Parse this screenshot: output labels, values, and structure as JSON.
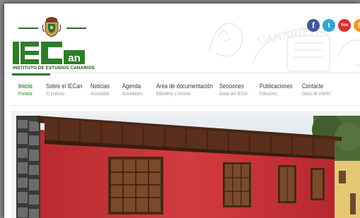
{
  "site": {
    "name_mark": "IECan",
    "tagline": "INSTITUTO DE ESTUDIOS CANARIOS",
    "watermark_text": "CANARIENSIUM"
  },
  "social": [
    {
      "name": "facebook-icon",
      "glyph": "f"
    },
    {
      "name": "twitter-icon",
      "glyph": "t"
    },
    {
      "name": "youtube-icon",
      "glyph": "You"
    },
    {
      "name": "rss-icon",
      "glyph": "S"
    }
  ],
  "nav": [
    {
      "title": "Inicio",
      "subtitle": "Portada",
      "active": true
    },
    {
      "title": "Sobre el IECan",
      "subtitle": "El Instituto",
      "active": false
    },
    {
      "title": "Noticias",
      "subtitle": "Actualidad",
      "active": false
    },
    {
      "title": "Agenda",
      "subtitle": "Actividades",
      "active": false
    },
    {
      "title": "Área de documentación",
      "subtitle": "Biblioteca y Archivo",
      "active": false
    },
    {
      "title": "Secciones",
      "subtitle": "Áreas del IECan",
      "active": false
    },
    {
      "title": "Publicaciones",
      "subtitle": "Ediciones",
      "active": false
    },
    {
      "title": "Contacte",
      "subtitle": "Datos de interés",
      "active": false
    }
  ],
  "colors": {
    "brand_green": "#2e7d2a",
    "facade_red": "#c9343a",
    "wood_brown": "#5a2f1c"
  }
}
